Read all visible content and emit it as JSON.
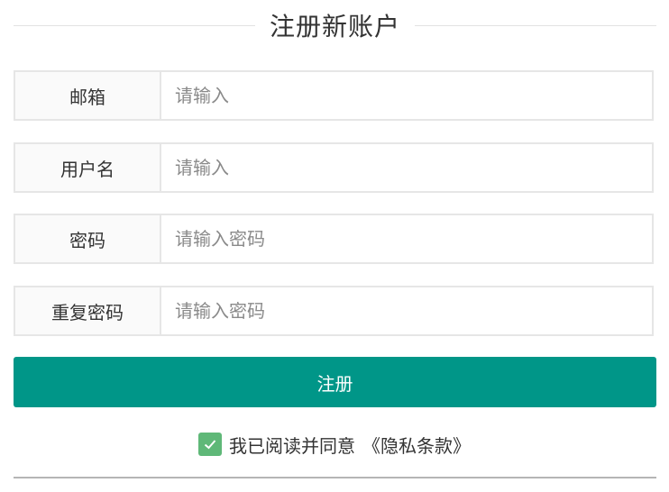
{
  "form": {
    "title": "注册新账户",
    "fields": [
      {
        "label": "邮箱",
        "placeholder": "请输入",
        "value": ""
      },
      {
        "label": "用户名",
        "placeholder": "请输入",
        "value": ""
      },
      {
        "label": "密码",
        "placeholder": "请输入密码",
        "value": ""
      },
      {
        "label": "重复密码",
        "placeholder": "请输入密码",
        "value": ""
      }
    ],
    "submit_label": "注册",
    "agree": {
      "checked": true,
      "text": "我已阅读并同意",
      "link_text": "《隐私条款》"
    }
  },
  "colors": {
    "primary": "#009688",
    "checkbox": "#5fb878",
    "border": "#e6e6e6",
    "label_bg": "#fafafa"
  },
  "icons": {
    "checkbox": "check-icon"
  }
}
